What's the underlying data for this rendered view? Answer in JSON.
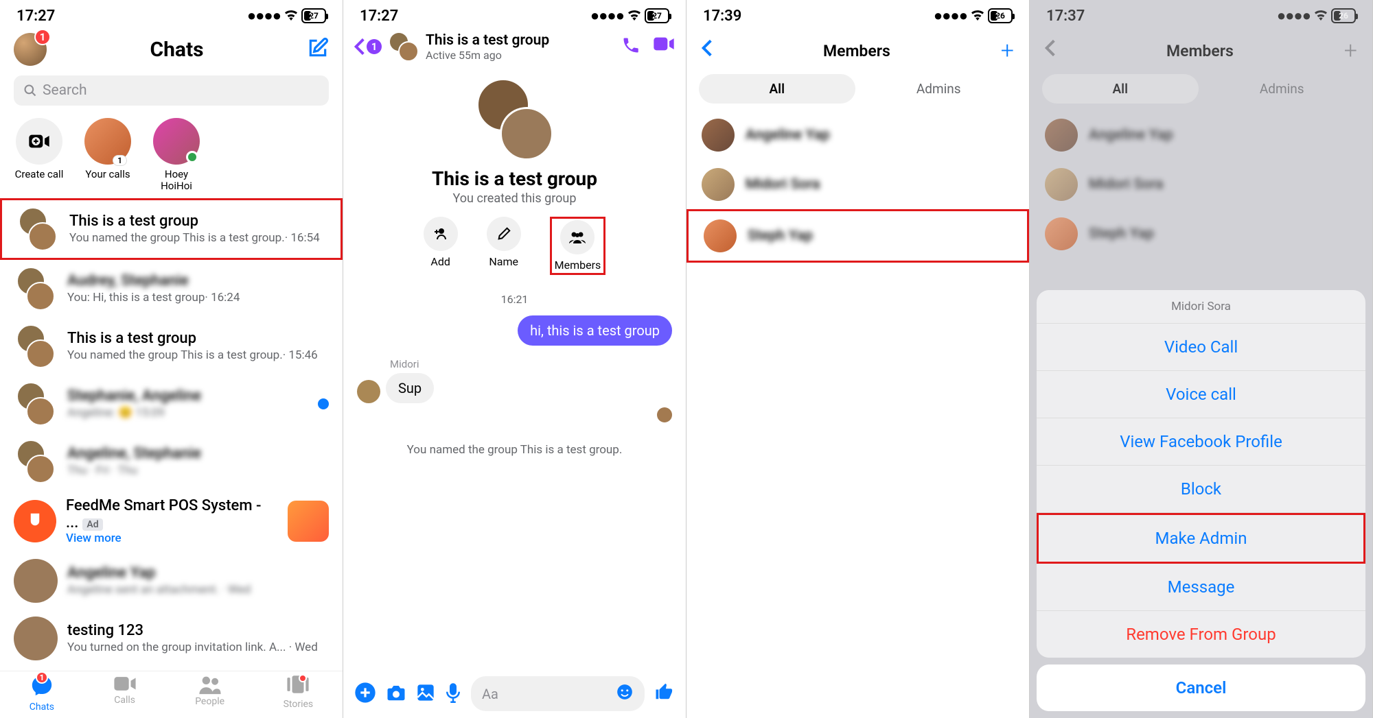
{
  "status": {
    "t1": "17:27",
    "t2": "17:27",
    "t3": "17:39",
    "t4": "17:37",
    "batt1": "27",
    "batt2": "27",
    "batt3": "26",
    "batt4": "26"
  },
  "p1": {
    "badge": "1",
    "title": "Chats",
    "search_placeholder": "Search",
    "stories": {
      "create": "Create call",
      "calls": "Your calls",
      "calls_badge": "1",
      "hoey": "Hoey HoiHoi"
    },
    "chats": [
      {
        "title": "This is a test group",
        "sub": "You named the group This is a test group.· 16:54"
      },
      {
        "title": "Audrey, Stephanie",
        "sub": "You: Hi, this is a test group· 16:24"
      },
      {
        "title": "This is a test group",
        "sub": "You named the group This is a test group.· 15:46"
      },
      {
        "title": "Stephanie, Angeline",
        "sub": "Angeline: 😊  15:09"
      },
      {
        "title": "Angeline, Stephanie",
        "sub": "Thu · Fri · Thu"
      },
      {
        "title": "FeedMe Smart POS System - ...",
        "sub": "View more",
        "ad": "Ad"
      },
      {
        "title": "Angeline Yap",
        "sub": "Angeline sent an attachment. · Wed"
      },
      {
        "title": "testing 123",
        "sub": "You turned on the group invitation link. A... · Wed"
      }
    ],
    "tabs": {
      "chats": "Chats",
      "chats_badge": "1",
      "calls": "Calls",
      "people": "People",
      "stories": "Stories"
    }
  },
  "p2": {
    "back_badge": "1",
    "title": "This is a test group",
    "subtitle": "Active 55m ago",
    "hero_title": "This is a test group",
    "hero_sub": "You created this group",
    "actions": {
      "add": "Add",
      "name": "Name",
      "members": "Members"
    },
    "time": "16:21",
    "msg_out": "hi, this is a test group",
    "sender": "Midori",
    "msg_in": "Sup",
    "sys": "You named the group This is a test group.",
    "composer_placeholder": "Aa"
  },
  "p3": {
    "title": "Members",
    "tab_all": "All",
    "tab_admins": "Admins",
    "members": [
      "Angeline Yap",
      "Midori Sora",
      "Steph Yap"
    ]
  },
  "p4": {
    "title": "Members",
    "tab_all": "All",
    "tab_admins": "Admins",
    "members": [
      "Angeline Yap",
      "Midori Sora",
      "Steph Yap"
    ],
    "sheet_name": "Midori Sora",
    "sheet": {
      "video": "Video Call",
      "voice": "Voice call",
      "profile": "View Facebook Profile",
      "block": "Block",
      "make_admin": "Make Admin",
      "message": "Message",
      "remove": "Remove From Group",
      "cancel": "Cancel"
    }
  }
}
